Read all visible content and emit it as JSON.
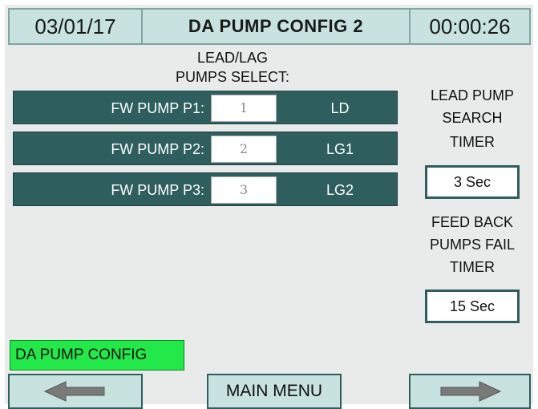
{
  "header": {
    "date": "03/01/17",
    "title": "DA PUMP CONFIG 2",
    "time": "00:00:26"
  },
  "lead_lag": {
    "title_line1": "LEAD/LAG",
    "title_line2": "PUMPS SELECT:",
    "pumps": [
      {
        "label": "FW PUMP P1:",
        "value": "1",
        "role": "LD"
      },
      {
        "label": "FW PUMP P2:",
        "value": "2",
        "role": "LG1"
      },
      {
        "label": "FW PUMP P3:",
        "value": "3",
        "role": "LG2"
      }
    ]
  },
  "lead_timer": {
    "label_line1": "LEAD PUMP",
    "label_line2": "SEARCH",
    "label_line3": "TIMER",
    "value": "3 Sec"
  },
  "feedback_timer": {
    "label_line1": "FEED BACK",
    "label_line2": "PUMPS FAIL",
    "label_line3": "TIMER",
    "value": "15 Sec"
  },
  "buttons": {
    "config": "DA PUMP CONFIG",
    "main_menu": "MAIN MENU",
    "prev_icon": "arrow-left-icon",
    "next_icon": "arrow-right-icon"
  },
  "colors": {
    "header_bg": "#c7e2df",
    "row_bg": "#2e5e5d",
    "config_button": "#22e84a"
  }
}
